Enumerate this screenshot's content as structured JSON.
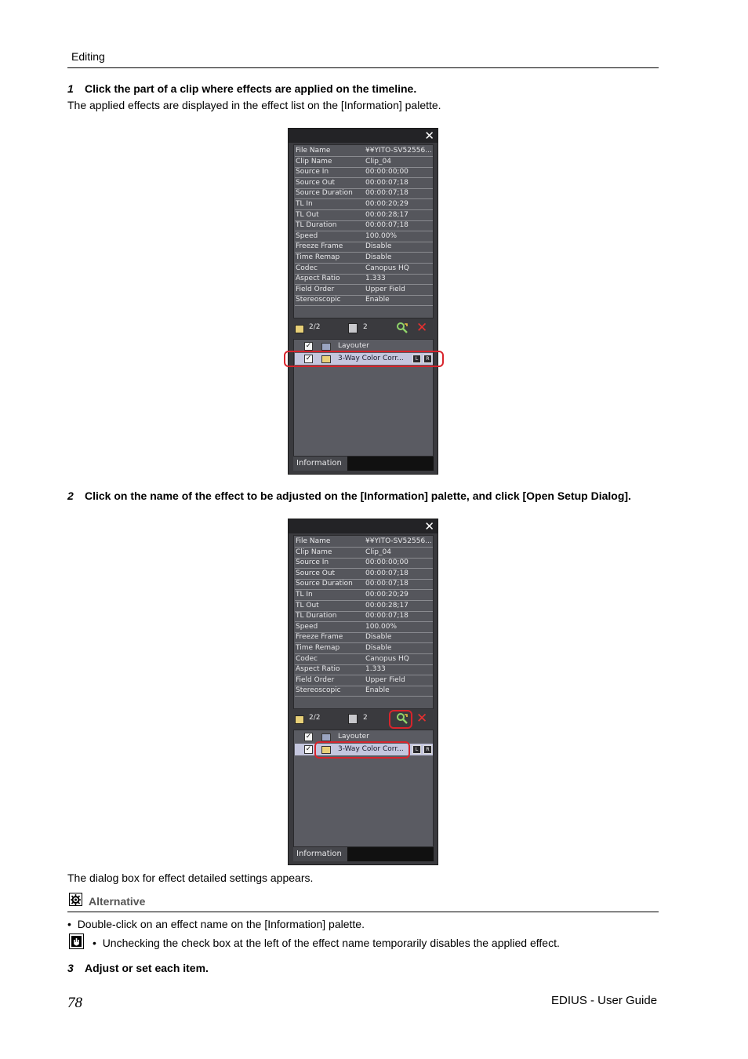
{
  "header": {
    "section": "Editing"
  },
  "steps": [
    {
      "num": "1",
      "text": "Click the part of a clip where effects are applied on the timeline."
    },
    {
      "num": "2",
      "text": "Click on the name of the effect to be adjusted on the [Information] palette, and click [Open Setup Dialog]."
    },
    {
      "num": "3",
      "text": "Adjust or set each item."
    }
  ],
  "step1_result": "The applied effects are displayed in the effect list on the [Information] palette.",
  "step2_result": "The dialog box for effect detailed settings appears.",
  "palette": {
    "close_glyph": "✕",
    "rows": [
      {
        "key": "File Name",
        "value": "¥¥YITO-SV52556..."
      },
      {
        "key": "Clip Name",
        "value": "Clip_04"
      },
      {
        "key": "Source In",
        "value": "00:00:00;00"
      },
      {
        "key": "Source Out",
        "value": "00:00:07;18"
      },
      {
        "key": "Source Duration",
        "value": "00:00:07;18"
      },
      {
        "key": "TL In",
        "value": "00:00:20;29"
      },
      {
        "key": "TL Out",
        "value": "00:00:28;17"
      },
      {
        "key": "TL Duration",
        "value": "00:00:07;18"
      },
      {
        "key": "Speed",
        "value": "100.00%"
      },
      {
        "key": "Freeze Frame",
        "value": "Disable"
      },
      {
        "key": "Time Remap",
        "value": "Disable"
      },
      {
        "key": "Codec",
        "value": "Canopus HQ"
      },
      {
        "key": "Aspect Ratio",
        "value": "1.333"
      },
      {
        "key": "Field Order",
        "value": "Upper Field"
      },
      {
        "key": "Stereoscopic",
        "value": "Enable"
      }
    ],
    "video_filter_count": "2/2",
    "audio_filter_count": "2",
    "effects": [
      {
        "name": "Layouter",
        "checked": true
      },
      {
        "name": "3-Way Color Corr...",
        "checked": true,
        "selected": true,
        "buttons": [
          "L",
          "R"
        ]
      }
    ],
    "tab_label": "Information",
    "highlight_color": "#d8242c"
  },
  "alternative": {
    "label": "Alternative",
    "bullet": "Double-click on an effect name on the [Information] palette."
  },
  "note": "Unchecking the check box at the left of the effect name temporarily disables the applied effect.",
  "footer": {
    "page": "78",
    "title": "EDIUS - User Guide"
  }
}
